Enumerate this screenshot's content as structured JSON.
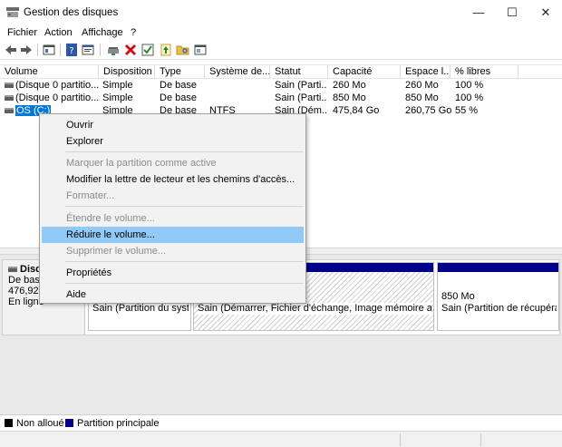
{
  "window": {
    "title": "Gestion des disques",
    "minimize": "—",
    "maximize": "☐",
    "close": "✕"
  },
  "menu": [
    "Fichier",
    "Action",
    "Affichage",
    "?"
  ],
  "toolbar": {
    "icons": [
      "back-arrow-icon",
      "forward-arrow-icon",
      "console-tree-icon",
      "help-icon",
      "properties-icon",
      "connect-drive-icon",
      "delete-icon",
      "check-icon",
      "export-icon",
      "search-folder-icon",
      "window-icon"
    ]
  },
  "table": {
    "columns": [
      "Volume",
      "Disposition",
      "Type",
      "Système de...",
      "Statut",
      "Capacité",
      "Espace l...",
      "% libres"
    ],
    "rows": [
      {
        "volume": "(Disque 0 partitio...",
        "disposition": "Simple",
        "type": "De base",
        "fs": "",
        "status": "Sain (Parti...",
        "capacity": "260 Mo",
        "free": "260 Mo",
        "pct": "100 %"
      },
      {
        "volume": "(Disque 0 partitio...",
        "disposition": "Simple",
        "type": "De base",
        "fs": "",
        "status": "Sain (Parti...",
        "capacity": "850 Mo",
        "free": "850 Mo",
        "pct": "100 %"
      },
      {
        "volume": "OS (C:)",
        "disposition": "Simple",
        "type": "De base",
        "fs": "NTFS",
        "status": "Sain (Dém...",
        "capacity": "475,84 Go",
        "free": "260,75 Go",
        "pct": "55 %"
      }
    ]
  },
  "disk": {
    "name": "Disq",
    "type": "De base",
    "size": "476,92 G",
    "status": "En ligne",
    "partitions": [
      {
        "status": "Sain (Partition du systè"
      },
      {
        "status": "Sain (Démarrer, Fichier d'échange, Image mémoire après in"
      },
      {
        "size": "850 Mo",
        "status": "Sain (Partition de récupératio"
      }
    ]
  },
  "legend": [
    {
      "label": "Non alloué",
      "color": "#000000"
    },
    {
      "label": "Partition principale",
      "color": "#00008b"
    }
  ],
  "context_menu": {
    "items": [
      {
        "label": "Ouvrir",
        "enabled": true
      },
      {
        "label": "Explorer",
        "enabled": true
      },
      {
        "label": "Marquer la partition comme active",
        "enabled": false
      },
      {
        "label": "Modifier la lettre de lecteur et les chemins d'accès...",
        "enabled": true
      },
      {
        "label": "Formater...",
        "enabled": false
      },
      {
        "label": "Étendre le volume...",
        "enabled": false
      },
      {
        "label": "Réduire le volume...",
        "enabled": true,
        "highlighted": true
      },
      {
        "label": "Supprimer le volume...",
        "enabled": false
      },
      {
        "label": "Propriétés",
        "enabled": true
      },
      {
        "label": "Aide",
        "enabled": true
      }
    ]
  },
  "colors": {
    "selection": "#0078d7",
    "menu_highlight": "#91c9f7",
    "primary_partition": "#00008b"
  }
}
